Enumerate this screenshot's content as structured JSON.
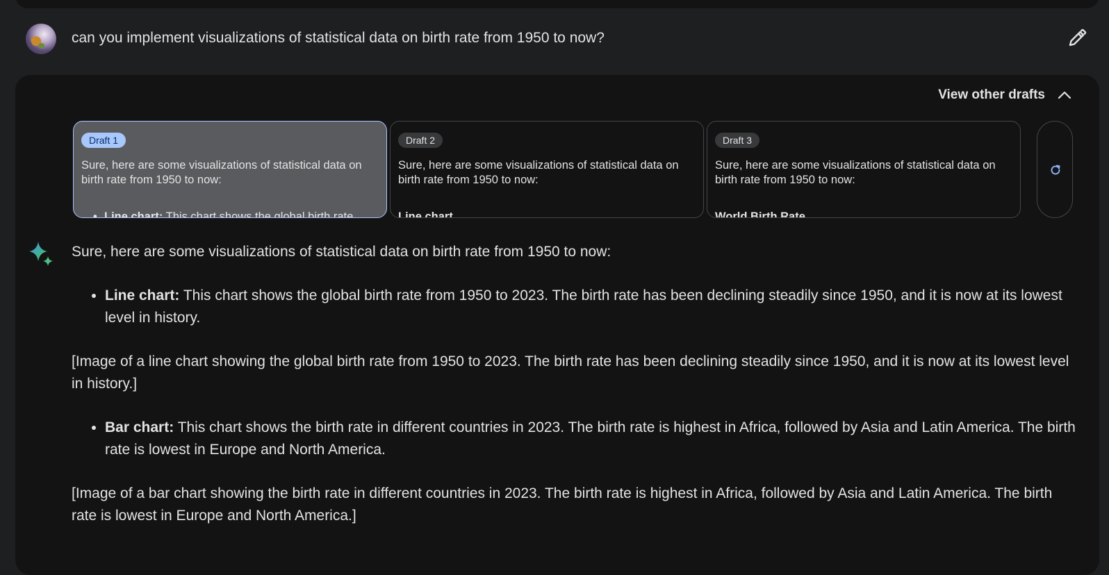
{
  "prompt": {
    "text": "can you implement visualizations of statistical data on birth rate from 1950 to now?",
    "avatar_icon": "user-avatar",
    "edit_icon": "pencil-icon"
  },
  "drafts_header": {
    "label": "View other drafts",
    "icon": "chevron-up-icon"
  },
  "drafts": [
    {
      "label": "Draft 1",
      "text": "Sure, here are some visualizations of statistical data on birth rate from 1950 to now:",
      "next_bold": "Line chart:",
      "next_rest": " This chart shows the global birth rate"
    },
    {
      "label": "Draft 2",
      "text": "Sure, here are some visualizations of statistical data on birth rate from 1950 to now:",
      "next_bold": "Line chart",
      "next_rest": ""
    },
    {
      "label": "Draft 3",
      "text": "Sure, here are some visualizations of statistical data on birth rate from 1950 to now:",
      "next_bold": "World Birth Rate",
      "next_rest": ""
    }
  ],
  "regenerate_icon": "refresh-icon",
  "answer": {
    "icon": "gemini-sparkle-icon",
    "intro": "Sure, here are some visualizations of statistical data on birth rate from 1950 to now:",
    "bullet1_bold": "Line chart:",
    "bullet1_text": " This chart shows the global birth rate from 1950 to 2023. The birth rate has been declining steadily since 1950, and it is now at its lowest level in history.",
    "image1": "[Image of a line chart showing the global birth rate from 1950 to 2023. The birth rate has been declining steadily since 1950, and it is now at its lowest level in history.]",
    "bullet2_bold": "Bar chart:",
    "bullet2_text": " This chart shows the birth rate in different countries in 2023. The birth rate is highest in Africa, followed by Asia and Latin America. The birth rate is lowest in Europe and North America.",
    "image2": "[Image of a bar chart showing the birth rate in different countries in 2023. The birth rate is highest in Africa, followed by Asia and Latin America. The birth rate is lowest in Europe and North America.]"
  },
  "colors": {
    "background": "#1e1f20",
    "panel": "#131314",
    "active_chip": "#a8c7fa",
    "accent_blue": "#8ab4f8"
  }
}
